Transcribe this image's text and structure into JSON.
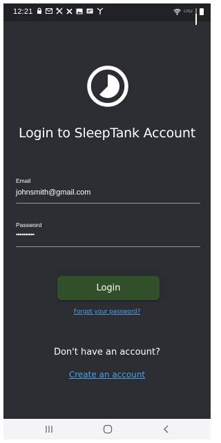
{
  "status_bar": {
    "time": "12:21",
    "left_icons": [
      "lock-icon",
      "mail-icon",
      "crossed-tools-icon",
      "close-icon",
      "image-icon",
      "card-icon",
      "antenna-icon"
    ],
    "right_icons": [
      "wifi-icon",
      "lte-icon",
      "signal-icon",
      "battery-icon"
    ],
    "network_label": "LTE2"
  },
  "logo": {
    "icon": "clock-pie-icon"
  },
  "title": "Login to SleepTank Account",
  "form": {
    "email_label": "Email",
    "email_value": "johnsmith@gmail.com",
    "password_label": "Password",
    "password_value": "••••••••••"
  },
  "login_button": "Login",
  "forgot_link": "Forgot your password?",
  "no_account_text": "Don't have an account?",
  "create_link": "Create an account",
  "nav_bar": {
    "recents_icon": "recents-icon",
    "home_icon": "home-icon",
    "back_icon": "back-icon"
  },
  "colors": {
    "background": "#2c2d33",
    "status_bar": "#212226",
    "button": "#315029",
    "link": "#4aa3e8",
    "nav_bar": "#f4f4f6"
  }
}
